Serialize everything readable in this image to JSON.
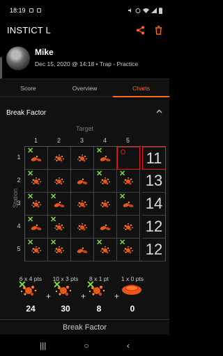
{
  "status_bar": {
    "time": "18:19",
    "battery": ""
  },
  "app_bar": {
    "title": "INSTICT L"
  },
  "profile": {
    "name": "Mike",
    "meta": "Dec 15, 2020 @ 14:18 • Trap - Practice"
  },
  "tabs": [
    {
      "label": "Score",
      "active": false
    },
    {
      "label": "Overview",
      "active": false
    },
    {
      "label": "Charts",
      "active": true
    }
  ],
  "section": {
    "title": "Break Factor"
  },
  "grid": {
    "target_label": "Target",
    "station_label": "Station",
    "columns": [
      "1",
      "2",
      "3",
      "4",
      "5"
    ],
    "rows": [
      "1",
      "2",
      "3",
      "4",
      "5"
    ],
    "cells": [
      [
        "x",
        "dust",
        "dust",
        "x",
        "o"
      ],
      [
        "x",
        "dust",
        "dust",
        "x",
        "x"
      ],
      [
        "x",
        "x",
        "dust",
        "dust",
        "x"
      ],
      [
        "x",
        "x",
        "dust",
        "dust",
        "dust"
      ],
      [
        "x",
        "x",
        "dust",
        "x",
        "x"
      ]
    ],
    "row_totals": [
      "11",
      "13",
      "14",
      "12",
      "12"
    ]
  },
  "legend": [
    {
      "points": "6 x 4 pts",
      "value": "24"
    },
    {
      "points": "10 x 3 pts",
      "value": "30"
    },
    {
      "points": "8 x 1 pt",
      "value": "8"
    },
    {
      "points": "1 x 0 pts",
      "value": "0"
    }
  ],
  "legend_plus": "+",
  "bottom_strip": {
    "label": "Break Factor"
  },
  "colors": {
    "accent": "#ff6a1a",
    "miss": "#e21b1b",
    "hit": "#7edb45",
    "background": "#111111"
  },
  "nav": {
    "recents": "|||",
    "home": "○",
    "back": "‹"
  }
}
